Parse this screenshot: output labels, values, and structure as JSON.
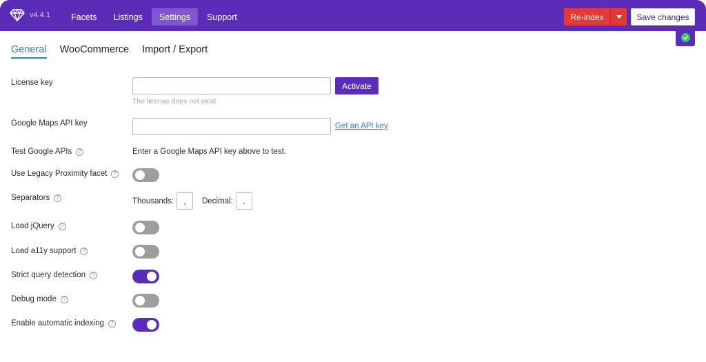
{
  "header": {
    "version": "v4.4.1",
    "nav": [
      {
        "label": "Facets"
      },
      {
        "label": "Listings"
      },
      {
        "label": "Settings",
        "active": true
      },
      {
        "label": "Support"
      }
    ],
    "reindex_label": "Re-index",
    "save_label": "Save changes",
    "brand_color": "#5b2cb8",
    "danger_color": "#e53935",
    "status_color": "#3cc46b",
    "icons": {
      "logo": "diamond-logo-icon",
      "status": "checkmark-circle-icon",
      "dropdown": "caret-down-icon"
    }
  },
  "subtabs": [
    {
      "label": "General",
      "active": true
    },
    {
      "label": "WooCommerce"
    },
    {
      "label": "Import / Export"
    }
  ],
  "settings": {
    "license": {
      "label": "License key",
      "value": "",
      "button": "Activate",
      "hint": "The license does not exist"
    },
    "gmaps": {
      "label": "Google Maps API key",
      "value": "",
      "link": "Get an API key"
    },
    "test_apis": {
      "label": "Test Google APIs",
      "text": "Enter a Google Maps API key above to test."
    },
    "legacy_proximity": {
      "label": "Use Legacy Proximity facet",
      "on": false
    },
    "separators": {
      "label": "Separators",
      "thousands_label": "Thousands:",
      "thousands_value": ",",
      "decimal_label": "Decimal:",
      "decimal_value": "."
    },
    "load_jquery": {
      "label": "Load jQuery",
      "on": false
    },
    "load_a11y": {
      "label": "Load a11y support",
      "on": false
    },
    "strict_query": {
      "label": "Strict query detection",
      "on": true
    },
    "debug_mode": {
      "label": "Debug mode",
      "on": false
    },
    "auto_indexing": {
      "label": "Enable automatic indexing",
      "on": true
    }
  }
}
